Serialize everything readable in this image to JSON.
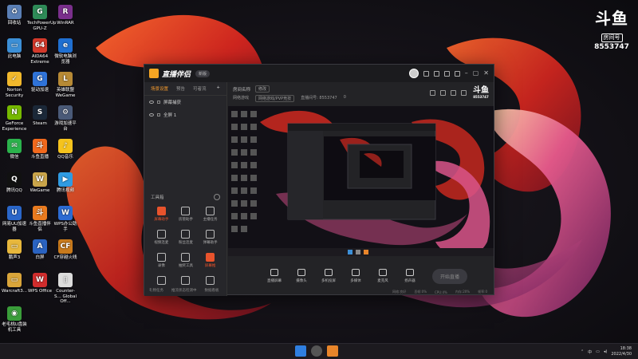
{
  "desktop": {
    "icons": [
      {
        "label": "回收站",
        "glyph": "♻",
        "color": "#5a7fb5"
      },
      {
        "label": "TechPowerUp GPU-Z",
        "glyph": "G",
        "color": "#2e8b57"
      },
      {
        "label": "WinRAR",
        "glyph": "R",
        "color": "#7a2f8c"
      },
      {
        "label": "此电脑",
        "glyph": "▭",
        "color": "#3c8fd6"
      },
      {
        "label": "AIDA64 Extreme",
        "glyph": "64",
        "color": "#d3392b"
      },
      {
        "label": "微软电脑浏览器",
        "glyph": "e",
        "color": "#1f6fd1"
      },
      {
        "label": "Norton Security",
        "glyph": "✓",
        "color": "#f1b82c"
      },
      {
        "label": "驱动加速",
        "glyph": "G",
        "color": "#2f73d8"
      },
      {
        "label": "英雄联盟WeGame",
        "glyph": "L",
        "color": "#b78a35"
      },
      {
        "label": "GeForce Experience",
        "glyph": "N",
        "color": "#76b900"
      },
      {
        "label": "Steam",
        "glyph": "S",
        "color": "#1b2838"
      },
      {
        "label": "游戏加速平台",
        "glyph": "⚙",
        "color": "#4a5a78"
      },
      {
        "label": "微信",
        "glyph": "✉",
        "color": "#2bb24c"
      },
      {
        "label": "斗鱼直播",
        "glyph": "斗",
        "color": "#f2691d"
      },
      {
        "label": "QQ音乐",
        "glyph": "♪",
        "color": "#f5c31d"
      },
      {
        "label": "腾讯QQ",
        "glyph": "Q",
        "color": "#111"
      },
      {
        "label": "WeGame",
        "glyph": "W",
        "color": "#caa54a"
      },
      {
        "label": "腾讯视频",
        "glyph": "▶",
        "color": "#2f9be2"
      },
      {
        "label": "网易UU加速器",
        "glyph": "U",
        "color": "#2a66c9"
      },
      {
        "label": "斗鱼直播伴侣",
        "glyph": "斗",
        "color": "#ea7b1f"
      },
      {
        "label": "WPS办公助手",
        "glyph": "W",
        "color": "#2c6bd3"
      },
      {
        "label": "鹏声3",
        "glyph": "▭",
        "color": "#e7b73c"
      },
      {
        "label": "白屏",
        "glyph": "A",
        "color": "#2a63c1"
      },
      {
        "label": "CF穿越火线",
        "glyph": "CF",
        "color": "#c97a1c"
      },
      {
        "label": "Warcraft3...",
        "glyph": "▭",
        "color": "#d9a53a"
      },
      {
        "label": "WPS Office",
        "glyph": "W",
        "color": "#d12d2d"
      },
      {
        "label": "Counter-S... Global Off...",
        "glyph": "▯",
        "color": "#dcdcdc"
      },
      {
        "label": "老毛桃U盘装机工具",
        "glyph": "◉",
        "color": "#3a9d3a"
      }
    ]
  },
  "watermark": {
    "logo": "斗鱼",
    "room_label": "房间号",
    "room_number": "8553747"
  },
  "app": {
    "title": "直播伴侣",
    "version": "新版",
    "scene_tabs": [
      "场景设置",
      "预告",
      "可者流"
    ],
    "scene_add": "+",
    "scenes": [
      "屏幕捕获",
      "全屏 1"
    ],
    "tools_title": "工具箱",
    "tools": [
      {
        "label": "屏幕助手",
        "hot": true
      },
      {
        "label": "房管助手",
        "hot": false
      },
      {
        "label": "主播任务",
        "hot": false
      },
      {
        "label": "视频连麦",
        "hot": false
      },
      {
        "label": "粉丝连麦",
        "hot": false
      },
      {
        "label": "弹幕助手",
        "hot": false
      },
      {
        "label": "录像",
        "hot": false
      },
      {
        "label": "抽奖工具",
        "hot": false
      },
      {
        "label": "屏幕推",
        "hot": true
      },
      {
        "label": "",
        "hot": false
      },
      {
        "label": "",
        "hot": false
      },
      {
        "label": "",
        "hot": false
      }
    ],
    "footer": [
      "礼物任务",
      "推流状态检测中",
      "数据看板"
    ],
    "stream": {
      "title": "房间名称",
      "edit": "修改",
      "category_label": "网络游戏",
      "category": "网络游戏/PVP竞技",
      "room_label": "直播间号: 8553747",
      "fans": "0"
    },
    "controls": [
      "直播屏幕",
      "摄像头",
      "多机投屏",
      "多媒体",
      "麦克风",
      "扬声器"
    ],
    "start_button": "开始直播",
    "status": [
      "网络:良好",
      "丢帧:0%",
      "CPU:4%",
      "内存:20%",
      "帧率:0"
    ]
  },
  "taskbar": {
    "time": "18:38",
    "date": "2022/4/30",
    "input_method": "中"
  }
}
